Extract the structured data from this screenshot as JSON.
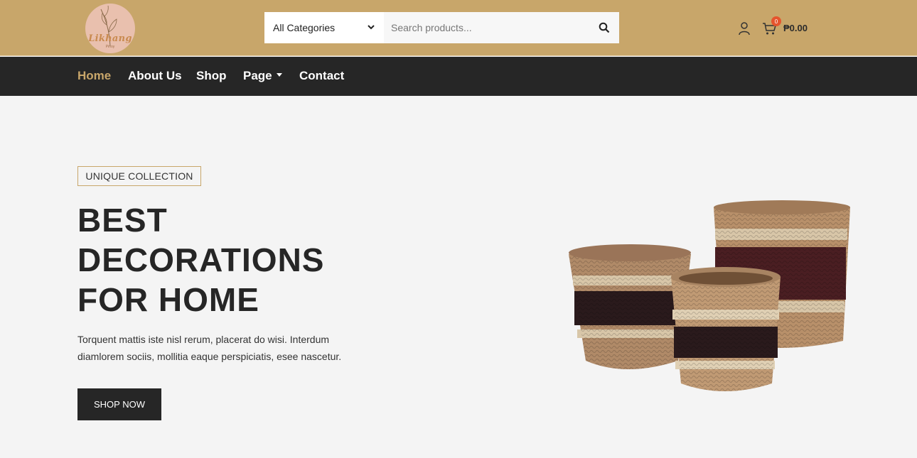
{
  "brand": {
    "logo_text": "Likhang",
    "logo_sub": "Pinoy"
  },
  "search": {
    "category_value": "All Categories",
    "placeholder": "Search products..."
  },
  "cart": {
    "count": "0",
    "total": "₱0.00"
  },
  "nav": {
    "items": [
      {
        "label": "Home",
        "active": true
      },
      {
        "label": "About Us"
      },
      {
        "label": "Shop"
      },
      {
        "label": "Page",
        "dropdown": true
      },
      {
        "label": "Contact"
      }
    ]
  },
  "hero": {
    "tag": "UNIQUE COLLECTION",
    "title_lines": [
      "BEST",
      "DECORATIONS",
      "FOR HOME"
    ],
    "description": "Torquent mattis iste nisl rerum, placerat do wisi. Interdum diamlorem sociis, mollitia eaque perspiciatis, esee nascetur.",
    "button": "SHOP NOW"
  },
  "colors": {
    "header_bg": "#c8a66a",
    "nav_bg": "#262626",
    "accent": "#c8a66a",
    "badge": "#e5542d"
  },
  "icons": [
    "search-icon",
    "user-icon",
    "cart-icon",
    "chevron-down-icon",
    "caret-down-icon"
  ]
}
